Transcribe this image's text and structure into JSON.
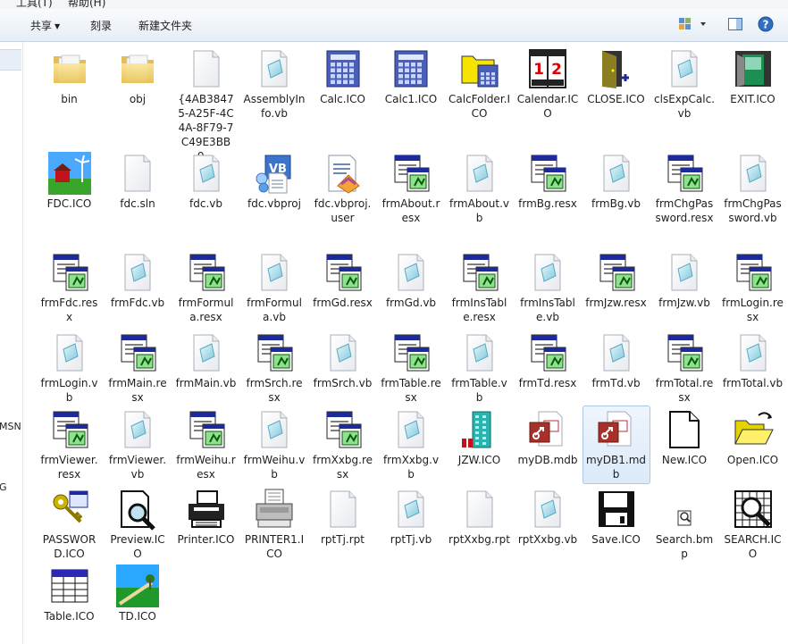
{
  "menubar": {
    "tools": "工具(T)",
    "help": "帮助(H)"
  },
  "toolbar": {
    "share": "共享",
    "burn": "刻录",
    "new_folder": "新建文件夹"
  },
  "leftpane": {
    "msn": "MSN",
    "g": "G"
  },
  "items": [
    {
      "label": "bin",
      "icon": "folder-icon"
    },
    {
      "label": "obj",
      "icon": "folder-icon"
    },
    {
      "label": "{4AB38475-A25F-4C4A-8F79-7C49E3BB9...",
      "icon": "blank-file-icon"
    },
    {
      "label": "AssemblyInfo.vb",
      "icon": "vb-file-icon"
    },
    {
      "label": "Calc.ICO",
      "icon": "calculator-icon"
    },
    {
      "label": "Calc1.ICO",
      "icon": "calculator-icon"
    },
    {
      "label": "CalcFolder.ICO",
      "icon": "calc-folder-icon"
    },
    {
      "label": "Calendar.ICO",
      "icon": "calendar-icon"
    },
    {
      "label": "CLOSE.ICO",
      "icon": "door-close-icon"
    },
    {
      "label": "clsExpCalc.vb",
      "icon": "vb-file-icon"
    },
    {
      "label": "EXIT.ICO",
      "icon": "exit-door-icon"
    },
    {
      "label": "FDC.ICO",
      "icon": "farm-image-icon"
    },
    {
      "label": "fdc.sln",
      "icon": "blank-file-icon"
    },
    {
      "label": "fdc.vb",
      "icon": "vb-file-icon"
    },
    {
      "label": "fdc.vbproj",
      "icon": "vbproj-icon"
    },
    {
      "label": "fdc.vbproj.user",
      "icon": "vbproj-user-icon"
    },
    {
      "label": "frmAbout.resx",
      "icon": "resx-icon"
    },
    {
      "label": "frmAbout.vb",
      "icon": "vb-file-icon"
    },
    {
      "label": "frmBg.resx",
      "icon": "resx-icon"
    },
    {
      "label": "frmBg.vb",
      "icon": "vb-file-icon"
    },
    {
      "label": "frmChgPassword.resx",
      "icon": "resx-icon"
    },
    {
      "label": "frmChgPassword.vb",
      "icon": "vb-file-icon"
    },
    {
      "label": "frmFdc.resx",
      "icon": "resx-icon"
    },
    {
      "label": "frmFdc.vb",
      "icon": "vb-file-icon"
    },
    {
      "label": "frmFormula.resx",
      "icon": "resx-icon"
    },
    {
      "label": "frmFormula.vb",
      "icon": "vb-file-icon"
    },
    {
      "label": "frmGd.resx",
      "icon": "resx-icon"
    },
    {
      "label": "frmGd.vb",
      "icon": "vb-file-icon"
    },
    {
      "label": "frmInsTable.resx",
      "icon": "resx-icon"
    },
    {
      "label": "frmInsTable.vb",
      "icon": "vb-file-icon"
    },
    {
      "label": "frmJzw.resx",
      "icon": "resx-icon"
    },
    {
      "label": "frmJzw.vb",
      "icon": "vb-file-icon"
    },
    {
      "label": "frmLogin.resx",
      "icon": "resx-icon"
    },
    {
      "label": "frmLogin.vb",
      "icon": "vb-file-icon"
    },
    {
      "label": "frmMain.resx",
      "icon": "resx-icon"
    },
    {
      "label": "frmMain.vb",
      "icon": "vb-file-icon"
    },
    {
      "label": "frmSrch.resx",
      "icon": "resx-icon"
    },
    {
      "label": "frmSrch.vb",
      "icon": "vb-file-icon"
    },
    {
      "label": "frmTable.resx",
      "icon": "resx-icon"
    },
    {
      "label": "frmTable.vb",
      "icon": "vb-file-icon"
    },
    {
      "label": "frmTd.resx",
      "icon": "resx-icon"
    },
    {
      "label": "frmTd.vb",
      "icon": "vb-file-icon"
    },
    {
      "label": "frmTotal.resx",
      "icon": "resx-icon"
    },
    {
      "label": "frmTotal.vb",
      "icon": "vb-file-icon"
    },
    {
      "label": "frmViewer.resx",
      "icon": "resx-icon"
    },
    {
      "label": "frmViewer.vb",
      "icon": "vb-file-icon"
    },
    {
      "label": "frmWeihu.resx",
      "icon": "resx-icon"
    },
    {
      "label": "frmWeihu.vb",
      "icon": "vb-file-icon"
    },
    {
      "label": "frmXxbg.resx",
      "icon": "resx-icon"
    },
    {
      "label": "frmXxbg.vb",
      "icon": "vb-file-icon"
    },
    {
      "label": "JZW.ICO",
      "icon": "building-icon"
    },
    {
      "label": "myDB.mdb",
      "icon": "access-db-icon"
    },
    {
      "label": "myDB1.mdb",
      "icon": "access-db-icon",
      "selected": true
    },
    {
      "label": "New.ICO",
      "icon": "new-page-icon"
    },
    {
      "label": "Open.ICO",
      "icon": "open-folder-icon"
    },
    {
      "label": "PASSWORD.ICO",
      "icon": "key-icon"
    },
    {
      "label": "Preview.ICO",
      "icon": "magnifier-page-icon"
    },
    {
      "label": "Printer.ICO",
      "icon": "printer-icon"
    },
    {
      "label": "PRINTER1.ICO",
      "icon": "printer-gray-icon"
    },
    {
      "label": "rptTj.rpt",
      "icon": "blank-file-icon"
    },
    {
      "label": "rptTj.vb",
      "icon": "vb-file-icon"
    },
    {
      "label": "rptXxbg.rpt",
      "icon": "blank-file-icon"
    },
    {
      "label": "rptXxbg.vb",
      "icon": "vb-file-icon"
    },
    {
      "label": "Save.ICO",
      "icon": "floppy-icon"
    },
    {
      "label": "Search.bmp",
      "icon": "small-search-icon"
    },
    {
      "label": "SEARCH.ICO",
      "icon": "search-grid-icon"
    },
    {
      "label": "Table.ICO",
      "icon": "table-icon"
    },
    {
      "label": "TD.ICO",
      "icon": "landscape-icon"
    }
  ]
}
